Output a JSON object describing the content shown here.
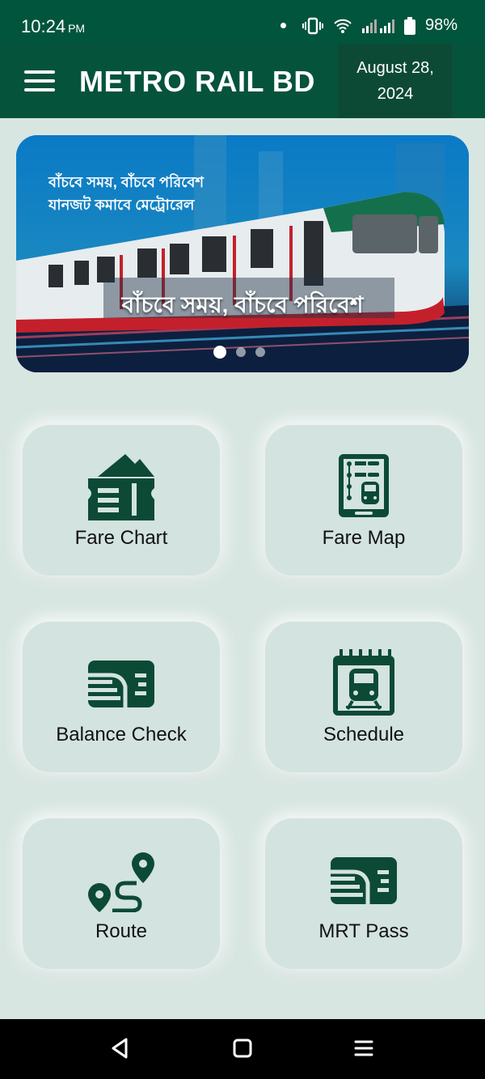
{
  "status": {
    "time": "10:24",
    "ampm": "PM",
    "battery": "98%"
  },
  "appbar": {
    "title": "METRO RAIL BD",
    "date_line1": "August 28,",
    "date_line2": "2024"
  },
  "banner": {
    "small_line1": "বাঁচবে সময়, বাঁচবে পরিবেশ",
    "small_line2": "যানজট কমাবে মেট্রোরেল",
    "caption": "বাঁচবে সময়, বাঁচবে পরিবেশ",
    "slide_count": 3,
    "active_slide": 1
  },
  "cards": [
    {
      "label": "Fare Chart",
      "icon": "ticket-icon"
    },
    {
      "label": "Fare Map",
      "icon": "fare-map-icon"
    },
    {
      "label": "Balance Check",
      "icon": "card-icon"
    },
    {
      "label": "Schedule",
      "icon": "train-calendar-icon"
    },
    {
      "label": "Route",
      "icon": "route-icon"
    },
    {
      "label": "MRT Pass",
      "icon": "mrt-pass-icon"
    }
  ],
  "colors": {
    "primary": "#06533c",
    "background": "#d8e6e2",
    "icon": "#0c4a36"
  }
}
